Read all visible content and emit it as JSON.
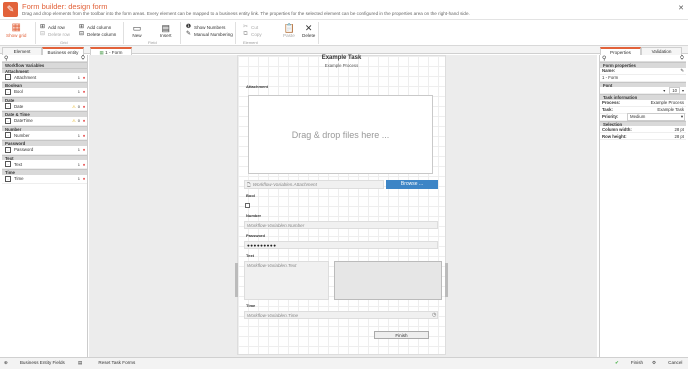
{
  "window": {
    "title": "Form builder: design form",
    "subtitle": "Drag and drop elements from the toolbar into the form areas. Every element can be mapped to a business entity link. The properties for the selected element can be configured in the properties area on the right-hand side."
  },
  "ribbon": {
    "show_grid": "Show grid",
    "add_row": "Add row",
    "delete_row": "Delete row",
    "grid_group": "Grid",
    "add_column": "Add column",
    "delete_column": "Delete column",
    "new": "New",
    "insert": "Insert",
    "field_group": "Field",
    "show_numbers": "Show Numbers",
    "manual_numbering": "Manual Numbering",
    "cut": "Cut",
    "copy": "Copy",
    "paste": "Paste",
    "delete": "Delete",
    "element_group": "Element"
  },
  "left_tabs": [
    "Element",
    "Business entity"
  ],
  "form_tab": "1 - Form",
  "right_tabs": [
    "Properties",
    "Validation"
  ],
  "entity_groups": [
    {
      "header": "Workflow Variables",
      "items": []
    },
    {
      "header": "Attachment",
      "items": [
        {
          "label": "Attachment",
          "count": "1",
          "req": true
        }
      ]
    },
    {
      "header": "Boolean",
      "items": [
        {
          "label": "Bool",
          "count": "1",
          "req": true
        }
      ]
    },
    {
      "header": "Date",
      "items": [
        {
          "label": "Date",
          "count": "0",
          "req": true,
          "warn": true
        }
      ]
    },
    {
      "header": "Date & Time",
      "items": [
        {
          "label": "DateTime",
          "count": "0",
          "req": true,
          "warn": true
        }
      ]
    },
    {
      "header": "Number",
      "items": [
        {
          "label": "Number",
          "count": "1",
          "req": true
        }
      ]
    },
    {
      "header": "Password",
      "items": [
        {
          "label": "Password",
          "count": "1",
          "req": true
        }
      ]
    },
    {
      "header": "Text",
      "items": [
        {
          "label": "Text",
          "count": "1",
          "req": true
        }
      ]
    },
    {
      "header": "Time",
      "items": [
        {
          "label": "Time",
          "count": "1",
          "req": true
        }
      ]
    }
  ],
  "form": {
    "title": "Example Task",
    "process": "Example Process",
    "attachment_label": "Attachment",
    "drop_text": "Drag & drop files here ...",
    "attachment_field": "Workflow-Variablen.Attachment",
    "browse": "Browse ...",
    "bool_label": "Bool",
    "number_label": "Number",
    "number_field": "Workflow-Variablen.Number",
    "password_label": "Password",
    "password_value": "●●●●●●●●●",
    "text_label": "Text",
    "text_field": "Workflow-Variablen.Text",
    "time_label": "Time",
    "time_field": "Workflow-Variablen.Time",
    "finish": "Finish"
  },
  "props": {
    "form_properties": "Form properties",
    "name_label": "Name:",
    "name_value": "1 - Form",
    "font": "Font",
    "font_size": "10",
    "task_information": "Task information",
    "process_label": "Process:",
    "process_value": "Example Process",
    "task_label": "Task:",
    "task_value": "Example Task",
    "priority_label": "Priority:",
    "priority_value": "Medium",
    "selection": "Selection",
    "colwidth_label": "Column width:",
    "colwidth_value": "28 pt",
    "rowheight_label": "Row height:",
    "rowheight_value": "28 pt"
  },
  "bottom": {
    "business_entity_fields": "Business Entity Fields",
    "reset_task_forms": "Reset Task Forms",
    "finish": "Finish",
    "cancel": "Cancel"
  }
}
